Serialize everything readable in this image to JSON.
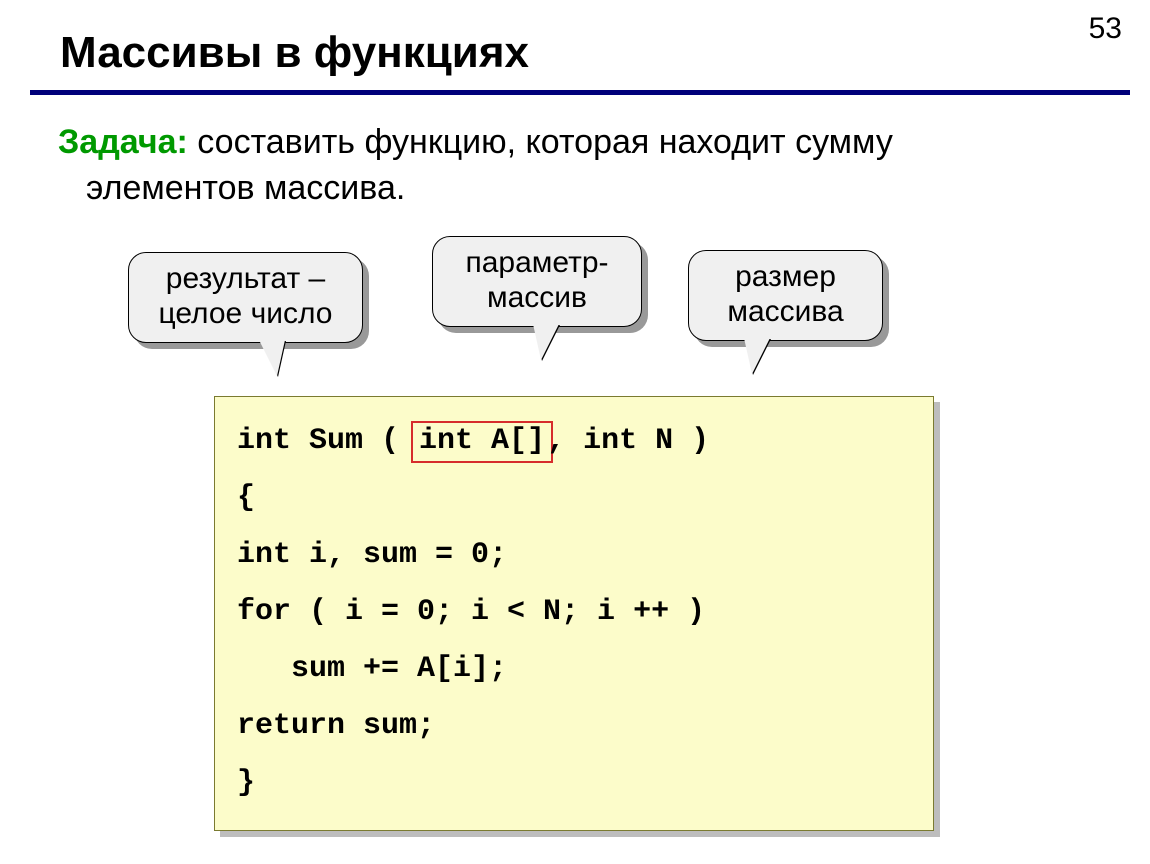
{
  "page_number": "53",
  "title": "Массивы в функциях",
  "task": {
    "label": "Задача:",
    "text_part1": " составить функцию, которая находит сумму",
    "text_part2": "элементов массива."
  },
  "callouts": {
    "result": {
      "line1": "результат –",
      "line2": "целое число"
    },
    "param": {
      "line1": "параметр-",
      "line2": "массив"
    },
    "size": {
      "line1": "размер",
      "line2": "массива"
    }
  },
  "code": {
    "l1a": "int Sum ( ",
    "l1_hl": "int A[]",
    "l1b": ", int N )",
    "l2": "{",
    "l3": "int i, sum = 0;",
    "l4": "for ( i = 0; i < N; i ++ )",
    "l5": "   sum += A[i];",
    "l6": "return sum;",
    "l7": "}"
  }
}
